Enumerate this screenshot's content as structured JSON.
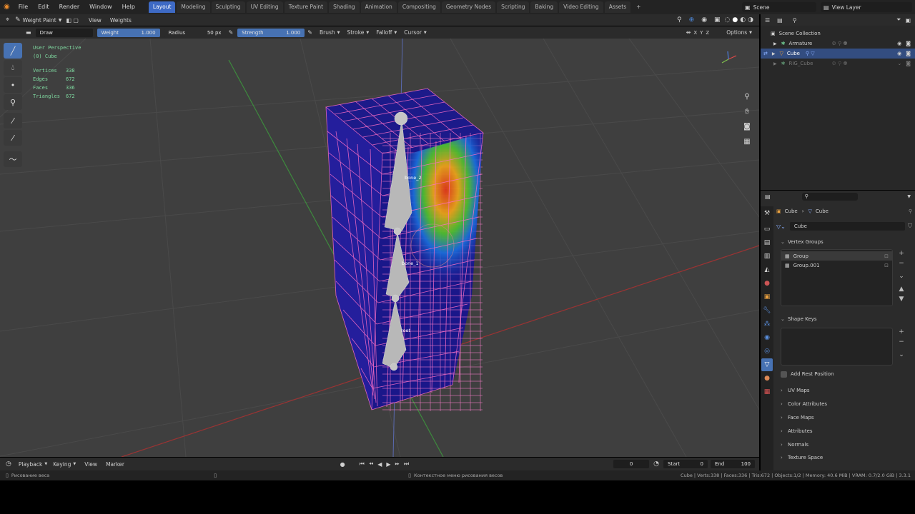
{
  "topbar": {
    "menus": [
      "File",
      "Edit",
      "Render",
      "Window",
      "Help"
    ],
    "workspaces": [
      "Layout",
      "Modeling",
      "Sculpting",
      "UV Editing",
      "Texture Paint",
      "Shading",
      "Animation",
      "Compositing",
      "Geometry Nodes",
      "Scripting",
      "Baking",
      "Video Editing",
      "Assets"
    ],
    "active_workspace": "Layout",
    "add_workspace": "+",
    "scene_label": "Scene",
    "view_layer_label": "View Layer"
  },
  "viewport_header": {
    "mode": "Weight Paint",
    "menus": [
      "View",
      "Weights"
    ],
    "options": "Options"
  },
  "tool_header": {
    "brush_name": "Draw",
    "weight_label": "Weight",
    "weight_value": "1.000",
    "radius_label": "Radius",
    "radius_value": "50 px",
    "strength_label": "Strength",
    "strength_value": "1.000",
    "menus": [
      "Brush",
      "Stroke",
      "Falloff",
      "Cursor"
    ]
  },
  "overlay": {
    "perspective": "User Perspective",
    "object": "(0) Cube",
    "stats": [
      {
        "label": "Vertices",
        "value": "338"
      },
      {
        "label": "Edges",
        "value": "672"
      },
      {
        "label": "Faces",
        "value": "336"
      },
      {
        "label": "Triangles",
        "value": "672"
      }
    ],
    "bones": [
      "bone_2",
      "bone_1",
      "root"
    ]
  },
  "timeline": {
    "menus": [
      "Playback",
      "Keying",
      "View",
      "Marker"
    ],
    "current_frame": "0",
    "start_label": "Start",
    "start_value": "0",
    "end_label": "End",
    "end_value": "100"
  },
  "statusbar": {
    "left_hint": "Рисование веса",
    "middle_hint": "Контекстное меню рисования весов",
    "right_info": "Cube | Verts:338 | Faces:336 | Tris:672 | Objects:1/2 | Memory: 40.6 MiB | VRAM: 0.7/2.0 GiB | 3.3.1"
  },
  "outliner": {
    "root": "Scene Collection",
    "items": [
      {
        "name": "Armature",
        "selected": false
      },
      {
        "name": "Cube",
        "selected": true
      },
      {
        "name": "RIG_Cube",
        "selected": false
      }
    ]
  },
  "properties": {
    "breadcrumb_object": "Cube",
    "breadcrumb_data": "Cube",
    "mesh_name": "Cube",
    "vertex_groups_title": "Vertex Groups",
    "vertex_groups": [
      "Group",
      "Group.001"
    ],
    "shape_keys_title": "Shape Keys",
    "add_rest_position": "Add Rest Position",
    "panels": [
      "UV Maps",
      "Color Attributes",
      "Face Maps",
      "Attributes",
      "Normals",
      "Texture Space"
    ]
  },
  "colors": {
    "accent": "#4772b3",
    "viewport_bg": "#3f3f3f",
    "stats_text": "#7fd9a0"
  }
}
